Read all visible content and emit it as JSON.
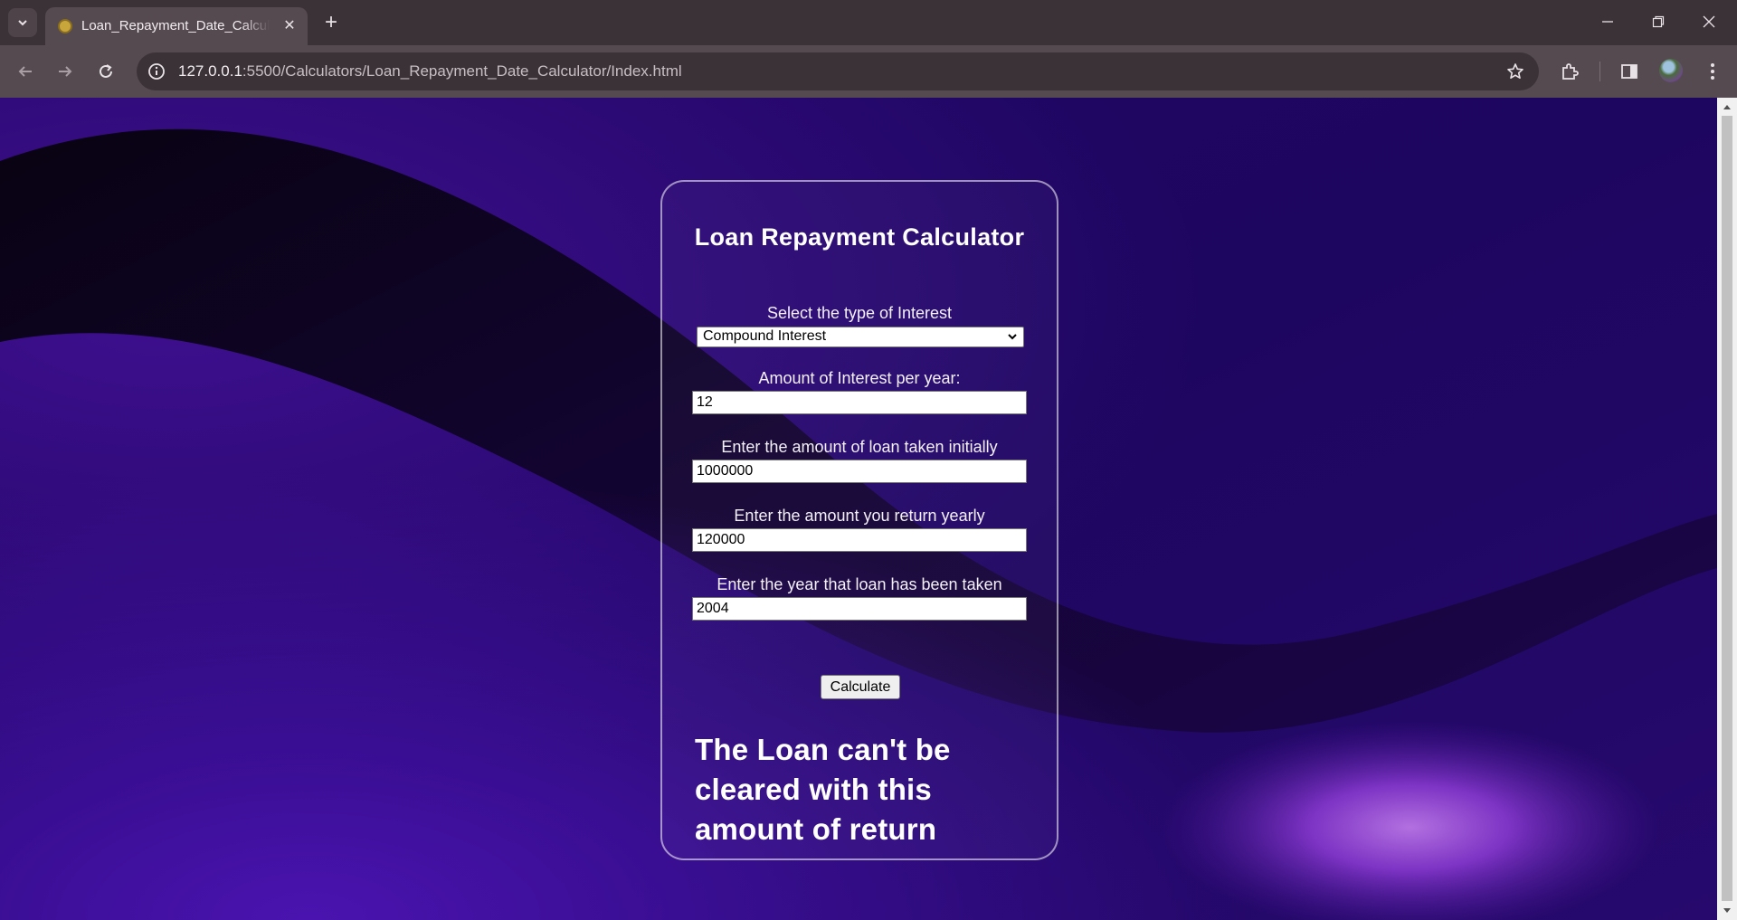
{
  "browser": {
    "tab_title": "Loan_Repayment_Date_Calculator",
    "url_host": "127.0.0.1",
    "url_path": ":5500/Calculators/Loan_Repayment_Date_Calculator/Index.html",
    "tab_close": "✕",
    "new_tab": "+"
  },
  "calculator": {
    "title": "Loan Repayment Calculator",
    "interest_type_label": "Select the type of Interest",
    "interest_type_value": "Compound Interest",
    "rate_label": "Amount of Interest per year:",
    "rate_value": "12",
    "loan_label": "Enter the amount of loan taken initially",
    "loan_value": "1000000",
    "return_label": "Enter the amount you return yearly",
    "return_value": "120000",
    "year_label": "Enter the year that loan has been taken",
    "year_value": "2004",
    "calculate_label": "Calculate",
    "result_text": "The Loan can't be cleared with this amount of return"
  }
}
